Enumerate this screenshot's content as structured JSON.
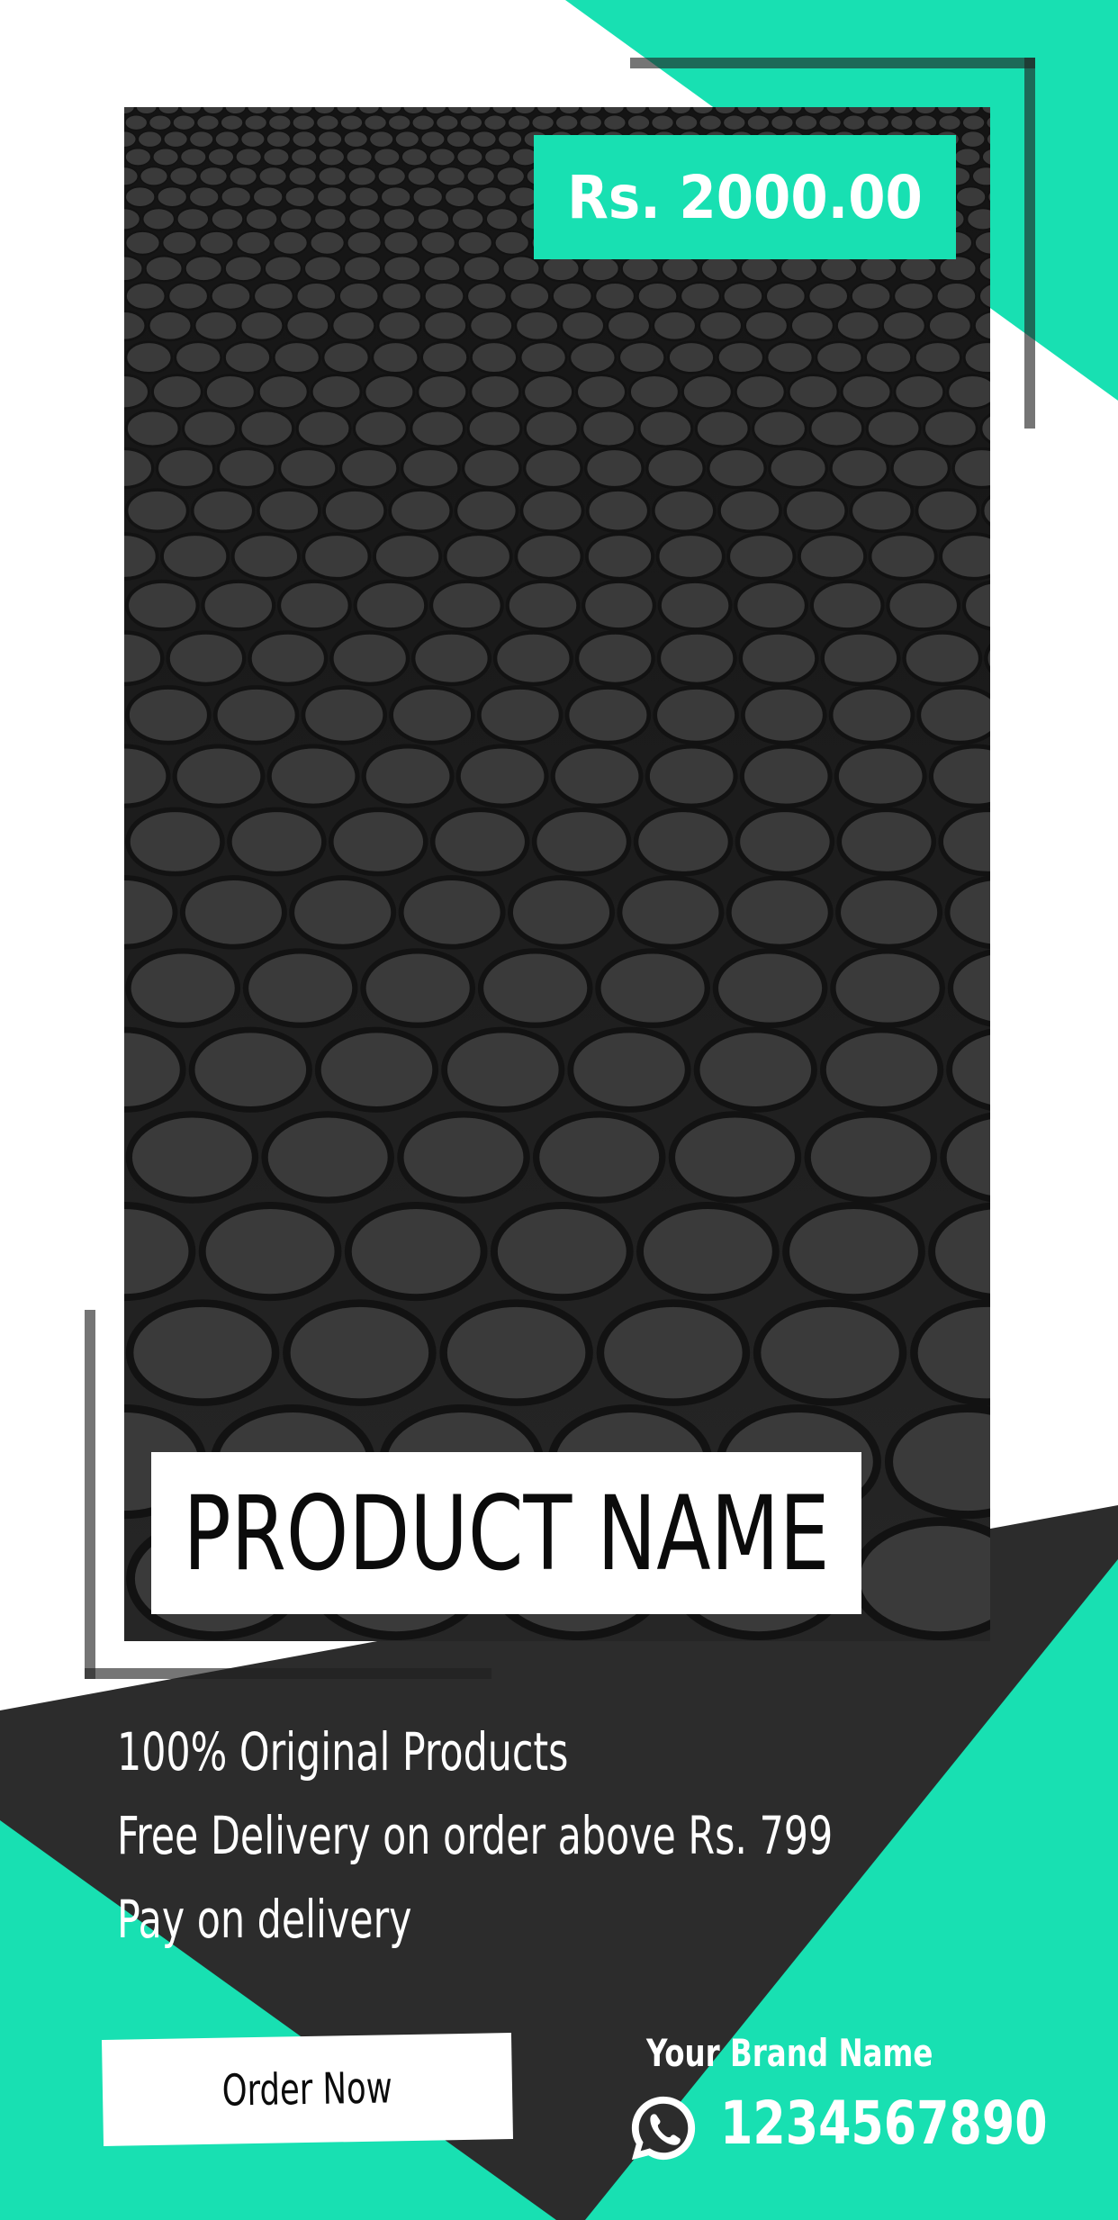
{
  "price": {
    "label": "Rs. 2000.00"
  },
  "product": {
    "name": "PRODUCT NAME"
  },
  "features": [
    "100% Original Products",
    "Free Delivery on order above Rs. 799",
    "Pay on delivery"
  ],
  "cta": {
    "label": "Order Now"
  },
  "brand": {
    "name": "Your Brand Name",
    "phone": "1234567890"
  },
  "colors": {
    "accent": "#18e0b2",
    "dark": "#2c2c2c",
    "white": "#ffffff",
    "text_dark": "#0b0b0b"
  },
  "icons": {
    "contact": "whatsapp-icon"
  }
}
